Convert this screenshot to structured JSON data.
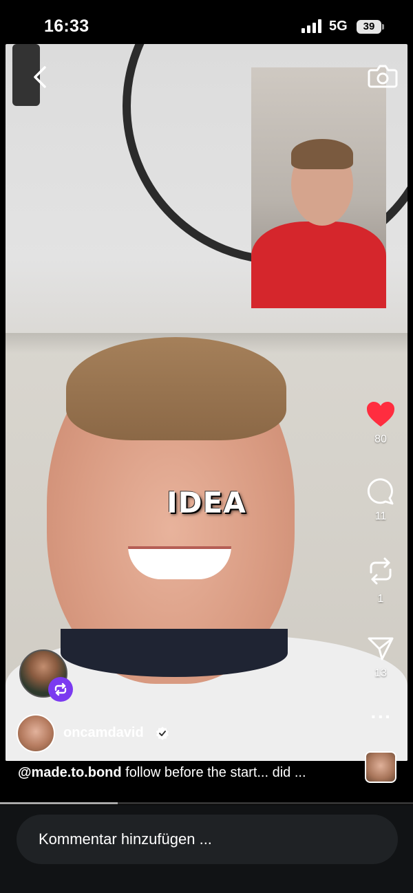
{
  "status_bar": {
    "time": "16:33",
    "network": "5G",
    "battery": "39"
  },
  "overlay": {
    "center_text": "IDEA"
  },
  "actions": {
    "like_count": "80",
    "comment_count": "11",
    "repost_count": "1",
    "share_count": "13"
  },
  "author": {
    "username": "oncamdavid"
  },
  "caption": {
    "mention": "@made.to.bond",
    "text": " follow before the start... did ..."
  },
  "comment_box": {
    "placeholder": "Kommentar hinzufügen ..."
  },
  "playback": {
    "progress": 0.285
  },
  "colors": {
    "like_red": "#ff2d3f",
    "remix_purple": "#7b3af0",
    "comment_bar": "#111315"
  },
  "icons": [
    "back-icon",
    "camera-icon",
    "heart-icon",
    "comment-icon",
    "repost-icon",
    "share-icon",
    "more-icon",
    "remix-icon",
    "verified-icon"
  ]
}
